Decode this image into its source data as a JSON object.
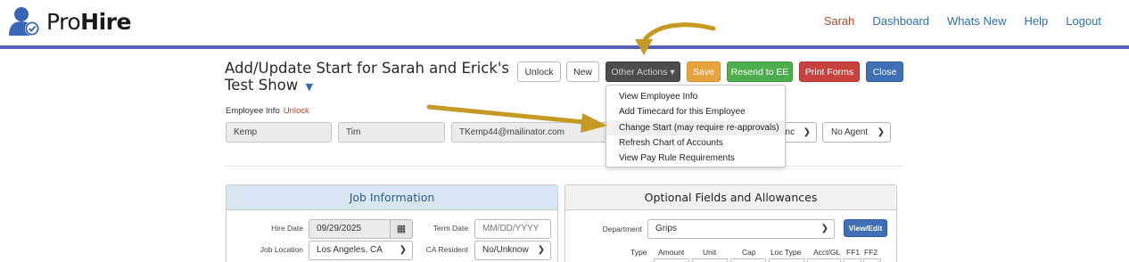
{
  "header": {
    "logo_light": "Pro",
    "logo_bold": "Hire",
    "nav": {
      "user": "Sarah",
      "dashboard": "Dashboard",
      "whats_new": "Whats New",
      "help": "Help",
      "logout": "Logout"
    }
  },
  "page": {
    "title": "Add/Update Start for Sarah and Erick's Test Show",
    "title_caret": "▼"
  },
  "toolbar": {
    "unlock": "Unlock",
    "new": "New",
    "other_actions": "Other Actions ▾",
    "save": "Save",
    "resend": "Resend to EE",
    "print": "Print Forms",
    "close": "Close"
  },
  "other_actions_menu": [
    "View Employee Info",
    "Add Timecard for this Employee",
    "Change Start (may require re-approvals)",
    "Refresh Chart of Accounts",
    "View Pay Rule Requirements"
  ],
  "employee": {
    "label": "Employee Info",
    "unlock_link": "Unlock",
    "last_name": "Kemp",
    "first_name": "Tim",
    "email": "TKemp44@mailinator.com",
    "union_select": "anc",
    "agent_select": "No Agent"
  },
  "job_info": {
    "heading": "Job Information",
    "hire_date_label": "Hire Date",
    "hire_date": "09/29/2025",
    "term_date_label": "Term Date",
    "term_date_placeholder": "MM/DD/YYYY",
    "job_location_label": "Job Location",
    "job_location": "Los Angeles, CA",
    "ca_resident_label": "CA Resident",
    "ca_resident": "No/Unknow"
  },
  "optional": {
    "heading": "Optional Fields and Allowances",
    "department_label": "Department",
    "department": "Grips",
    "view_edit": "View/Edit",
    "columns": [
      "Type",
      "Amount",
      "Unit",
      "Cap",
      "Loc Type",
      "Acct/GL",
      "FF1",
      "FF2"
    ]
  },
  "colors": {
    "brand_bar": "#5561b8",
    "accent_link": "#2f6db4",
    "user_link": "#b5472a",
    "annotation_arrow": "#c49a22"
  }
}
